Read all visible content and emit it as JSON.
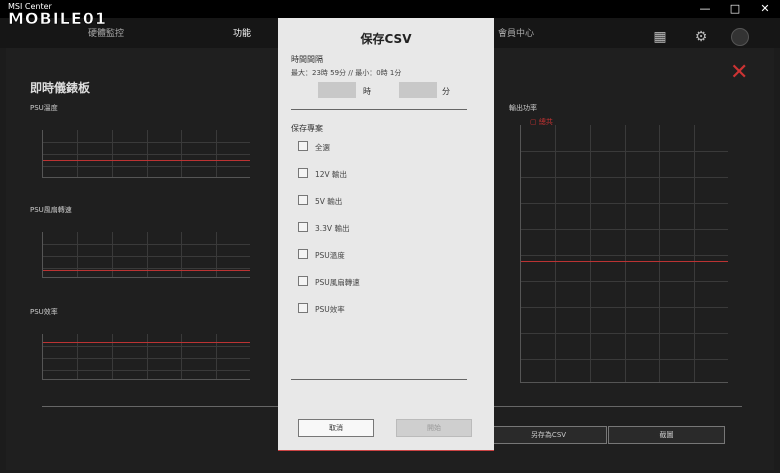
{
  "app": {
    "title": "MSI Center",
    "watermark": "MOBILE01"
  },
  "window": {
    "minimize": "—",
    "maximize": "□",
    "close": "✕"
  },
  "nav": {
    "tabs": [
      {
        "label": "硬體監控"
      },
      {
        "label": "功能"
      },
      {
        "label": "會員中心"
      }
    ]
  },
  "panel": {
    "title": "即時儀錶板",
    "charts": [
      {
        "label": "PSU溫度"
      },
      {
        "label": "PSU風扇轉速"
      },
      {
        "label": "PSU效率"
      },
      {
        "label": "輸出功率",
        "legend": "總共"
      }
    ],
    "buttons": {
      "save_csv": "另存為CSV",
      "screenshot": "截圖"
    }
  },
  "dialog": {
    "title": "保存CSV",
    "time_section": "時間間隔",
    "range": "最大：23時 59分 // 最小：0時 1分",
    "hour_unit": "時",
    "minute_unit": "分",
    "items_section": "保存專案",
    "items": [
      {
        "label": "全選",
        "checked": false
      },
      {
        "label": "12V 輸出",
        "checked": false
      },
      {
        "label": "5V 輸出",
        "checked": false
      },
      {
        "label": "3.3V 輸出",
        "checked": false
      },
      {
        "label": "PSU溫度",
        "checked": false
      },
      {
        "label": "PSU風扇轉速",
        "checked": false
      },
      {
        "label": "PSU效率",
        "checked": false
      }
    ],
    "cancel": "取消",
    "start": "開始"
  },
  "colors": {
    "accent": "#cc3333",
    "dialog_bg": "#e8e8e8"
  }
}
